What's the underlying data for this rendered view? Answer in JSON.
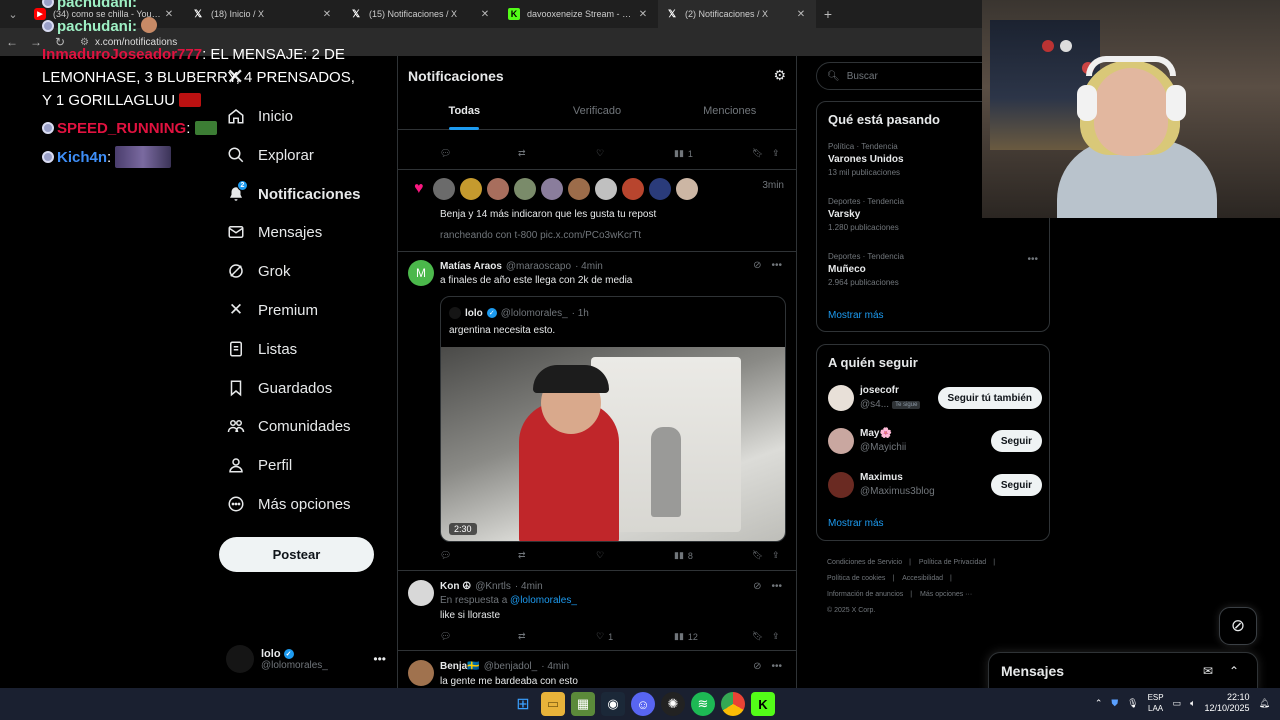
{
  "browser": {
    "tabs": [
      {
        "title": "(34) como se chilla - YouTube",
        "icon": "youtube-icon",
        "active": false
      },
      {
        "title": "(18) Inicio / X",
        "icon": "x-logo-icon",
        "active": false
      },
      {
        "title": "(15) Notificaciones / X",
        "icon": "x-logo-icon",
        "active": false
      },
      {
        "title": "davooxeneize Stream - Watch Liv",
        "icon": "kick-icon",
        "active": false
      },
      {
        "title": "(2) Notificaciones / X",
        "icon": "x-logo-icon",
        "active": true
      }
    ],
    "url": "x.com/notifications"
  },
  "chat": {
    "messages": [
      {
        "user": "pachudani:",
        "text": ""
      },
      {
        "user": "pachudani:",
        "text": ""
      },
      {
        "user": "InmaduroJoseador777",
        "text": ": EL MENSAJE: 2 DE LEMONHASE, 3 BLUBERRY, 4 PRENSADOS, Y 1 GORILLAGLUU"
      },
      {
        "user": "SPEED_RUNNING",
        "text": ":"
      },
      {
        "user": "Kich4n",
        "text": ":"
      }
    ]
  },
  "sidebar": {
    "items": [
      {
        "label": "Inicio",
        "icon": "home-icon"
      },
      {
        "label": "Explorar",
        "icon": "search-icon"
      },
      {
        "label": "Notificaciones",
        "icon": "bell-icon",
        "badge": "2"
      },
      {
        "label": "Mensajes",
        "icon": "mail-icon"
      },
      {
        "label": "Grok",
        "icon": "grok-icon"
      },
      {
        "label": "Premium",
        "icon": "x-logo-icon"
      },
      {
        "label": "Listas",
        "icon": "list-icon"
      },
      {
        "label": "Guardados",
        "icon": "bookmark-icon"
      },
      {
        "label": "Comunidades",
        "icon": "communities-icon"
      },
      {
        "label": "Perfil",
        "icon": "person-icon"
      },
      {
        "label": "Más opciones",
        "icon": "more-circle-icon"
      }
    ],
    "post_label": "Postear",
    "account": {
      "name": "lolo",
      "handle": "@lolomorales_"
    }
  },
  "main": {
    "title": "Notificaciones",
    "tabs": [
      "Todas",
      "Verificado",
      "Menciones"
    ],
    "top_actions": {
      "views": "1"
    },
    "like_notif": {
      "time": "3min",
      "text": "Benja y 14 más indicaron que les gusta tu repost",
      "subtext": "rancheando con t-800 pic.x.com/PCo3wKcrTt"
    },
    "post1": {
      "author": "Matías Araos",
      "handle": "@maraoscapo",
      "time": "· 4min",
      "text": "a finales de año este llega con 2k de media",
      "avatar_letter": "M",
      "quote": {
        "author": "lolo",
        "handle": "@lolomorales_",
        "time": "· 1h",
        "text": "argentina necesita esto.",
        "duration": "2:30"
      },
      "views": "8"
    },
    "post2": {
      "author": "Kon ☮",
      "handle": "@Knrtls",
      "time": "· 4min",
      "reply_prefix": "En respuesta a",
      "reply_to": "@lolomorales_",
      "text": "like si lloraste",
      "likes": "1",
      "views": "12"
    },
    "post3": {
      "author": "Benja🇸🇪",
      "handle": "@benjadol_",
      "time": "· 4min",
      "text": "la gente me bardeaba con esto"
    }
  },
  "right": {
    "search_placeholder": "Buscar",
    "trends_title": "Qué está pasando",
    "trends": [
      {
        "category": "Política · Tendencia",
        "name": "Varones Unidos",
        "count": "13 mil publicaciones"
      },
      {
        "category": "Deportes · Tendencia",
        "name": "Varsky",
        "count": "1.280 publicaciones"
      },
      {
        "category": "Deportes · Tendencia",
        "name": "Muñeco",
        "count": "2.964 publicaciones"
      }
    ],
    "trends_more": "Mostrar más",
    "follow_title": "A quién seguir",
    "follow": [
      {
        "name": "josecofr",
        "handle": "@s4...",
        "tag": "Te sigue",
        "button": "Seguir tú también"
      },
      {
        "name": "May🌸",
        "handle": "@Mayichii",
        "tag": "",
        "button": "Seguir"
      },
      {
        "name": "Maximus",
        "handle": "@Maximus3blog",
        "tag": "",
        "button": "Seguir"
      }
    ],
    "follow_more": "Mostrar más",
    "footer": [
      "Condiciones de Servicio",
      "Política de Privacidad",
      "Política de cookies",
      "Accesibilidad",
      "Información de anuncios",
      "Más opciones ···",
      "© 2025 X Corp."
    ],
    "messages_label": "Mensajes"
  },
  "taskbar": {
    "lang_top": "ESP",
    "lang_bottom": "LAA",
    "time": "22:10",
    "date": "12/10/2025"
  },
  "colors": {
    "accent": "#1d9bf0",
    "like": "#f91880",
    "bg": "#000000",
    "border": "#2f3336",
    "muted": "#71767b"
  }
}
